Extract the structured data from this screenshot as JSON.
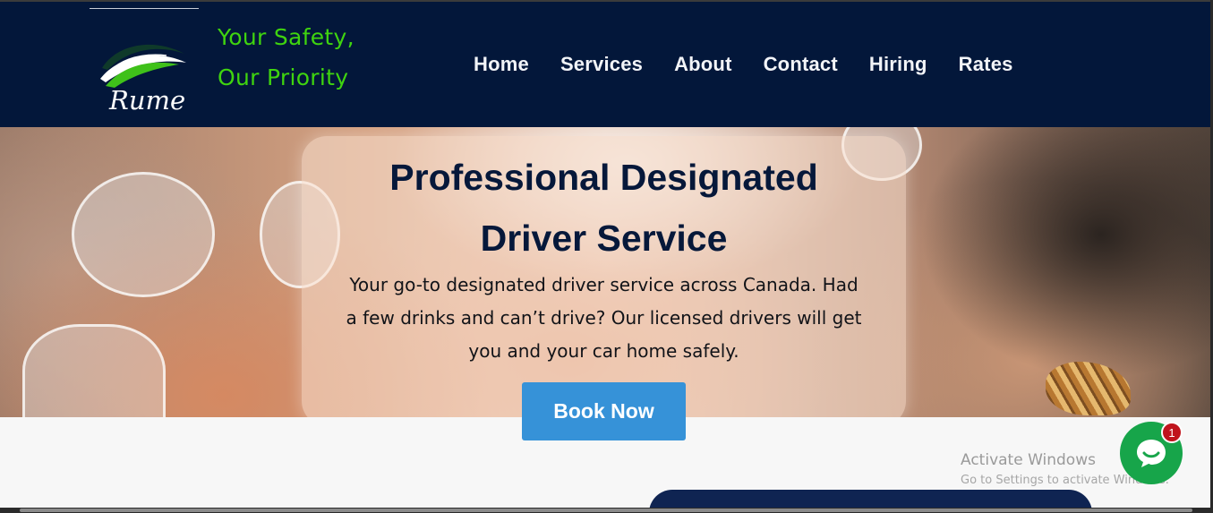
{
  "brand": {
    "logo_text": "Rume",
    "tagline_line1": "Your Safety,",
    "tagline_line2": "Our Priority",
    "accent_color": "#3fd40f",
    "header_color": "#03173a"
  },
  "nav": {
    "items": [
      {
        "label": "Home"
      },
      {
        "label": "Services"
      },
      {
        "label": "About"
      },
      {
        "label": "Contact"
      },
      {
        "label": "Hiring"
      },
      {
        "label": "Rates"
      }
    ]
  },
  "hero": {
    "title_line1": "Professional Designated",
    "title_line2": "Driver Service",
    "desc_line1": "Your go-to designated driver service across Canada. Had",
    "desc_line2": "a few drinks and can’t drive? Our licensed drivers will get",
    "desc_line3": "you and your car home safely.",
    "cta_label": "Book Now",
    "cta_color": "#3692d8"
  },
  "watermark": {
    "title": "Activate Windows",
    "subtitle": "Go to Settings to activate Windows."
  },
  "chat": {
    "icon": "chat-bubble-icon",
    "badge_count": "1",
    "color": "#17a54a"
  }
}
